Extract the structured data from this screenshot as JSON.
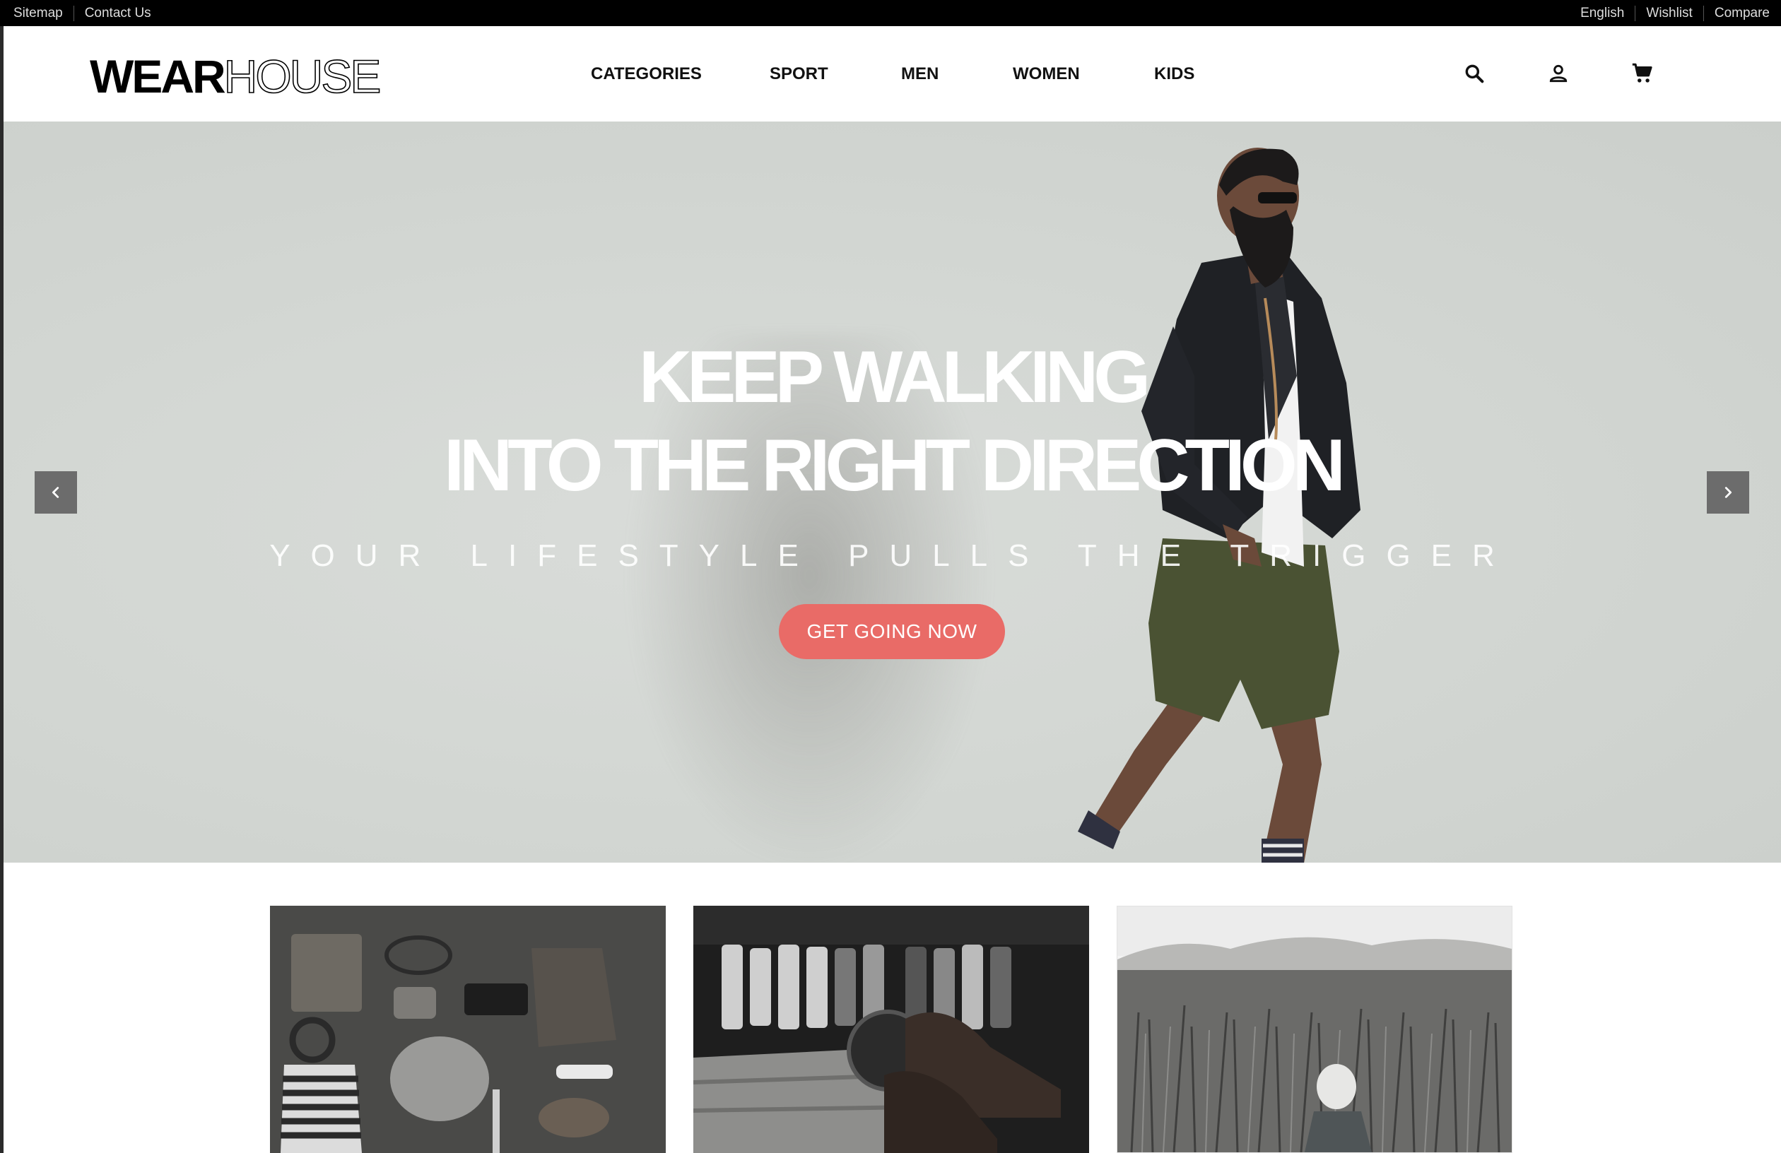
{
  "topbar": {
    "left_links": [
      "Sitemap",
      "Contact Us"
    ],
    "right_links": [
      "English",
      "Wishlist",
      "Compare"
    ]
  },
  "header": {
    "logo": {
      "bold": "WEAR",
      "light": "HOUSE"
    },
    "nav": [
      "CATEGORIES",
      "SPORT",
      "MEN",
      "WOMEN",
      "KIDS"
    ],
    "icons": [
      "search-icon",
      "user-icon",
      "cart-icon"
    ]
  },
  "hero": {
    "title_line1": "KEEP WALKING",
    "title_line2": "INTO THE RIGHT DIRECTION",
    "subtitle": "YOUR LIFESTYLE PULLS THE TRIGGER",
    "cta": "GET GOING NOW",
    "cta_color": "#e96b67",
    "prev_icon": "chevron-left-icon",
    "next_icon": "chevron-right-icon"
  },
  "tiles": [
    {
      "image": "flat-lay-accessories-image"
    },
    {
      "image": "shoes-and-clothes-image"
    },
    {
      "image": "field-child-image"
    }
  ]
}
